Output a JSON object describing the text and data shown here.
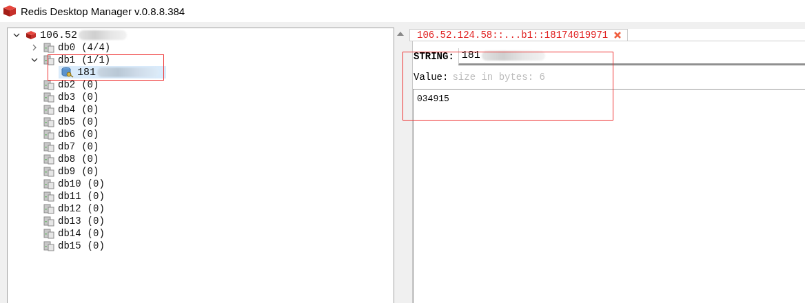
{
  "window": {
    "title": "Redis Desktop Manager v.0.8.8.384"
  },
  "tree": [
    {
      "label": "106.52",
      "expanded": true,
      "children": [
        {
          "name": "db0",
          "count": "(4/4)",
          "expanded": false
        },
        {
          "name": "db1",
          "count": "(1/1)",
          "expanded": true,
          "children": [
            {
              "label": "181",
              "selected": true
            }
          ]
        },
        {
          "name": "db2",
          "count": "(0)"
        },
        {
          "name": "db3",
          "count": "(0)"
        },
        {
          "name": "db4",
          "count": "(0)"
        },
        {
          "name": "db5",
          "count": "(0)"
        },
        {
          "name": "db6",
          "count": "(0)"
        },
        {
          "name": "db7",
          "count": "(0)"
        },
        {
          "name": "db8",
          "count": "(0)"
        },
        {
          "name": "db9",
          "count": "(0)"
        },
        {
          "name": "db10",
          "count": "(0)"
        },
        {
          "name": "db11",
          "count": "(0)"
        },
        {
          "name": "db12",
          "count": "(0)"
        },
        {
          "name": "db13",
          "count": "(0)"
        },
        {
          "name": "db14",
          "count": "(0)"
        },
        {
          "name": "db15",
          "count": "(0)"
        }
      ]
    }
  ],
  "tabs": [
    {
      "label": "106.52.124.58::...b1::18174019971",
      "selected": true
    }
  ],
  "key_editor": {
    "type_label": "STRING:",
    "key_value": "181",
    "value_label": "Value:",
    "size_hint": "size in bytes: 6",
    "value": "034915"
  }
}
